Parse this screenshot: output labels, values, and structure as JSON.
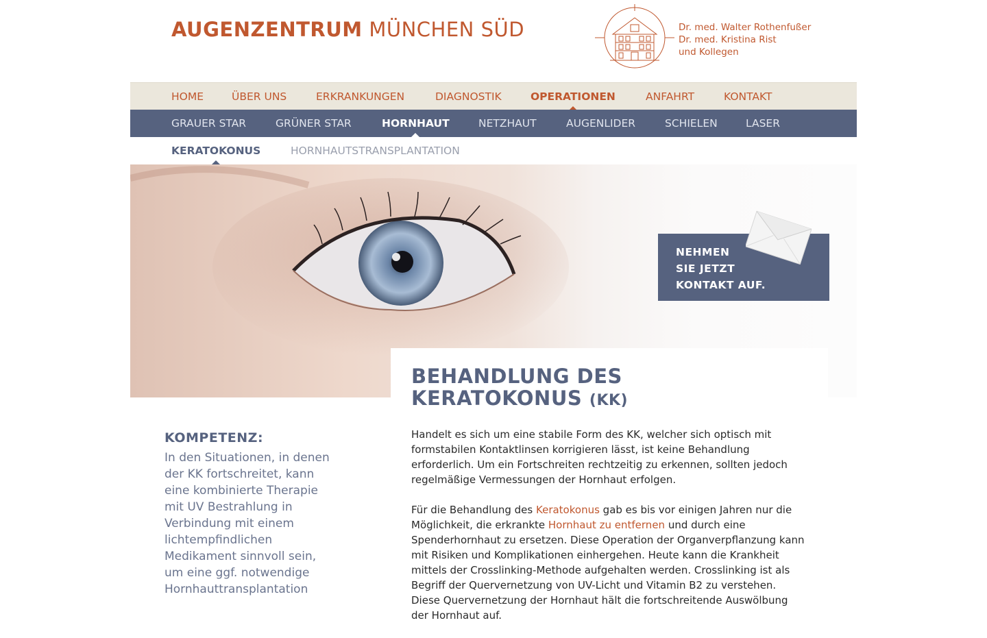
{
  "header": {
    "title_bold": "AUGENZENTRUM",
    "title_light": "MÜNCHEN SÜD",
    "doctors": [
      "Dr. med. Walter Rothenfußer",
      "Dr. med. Kristina Rist",
      "und Kollegen"
    ]
  },
  "nav_main": {
    "active": "OPERATIONEN",
    "items": [
      "HOME",
      "ÜBER UNS",
      "ERKRANKUNGEN",
      "DIAGNOSTIK",
      "OPERATIONEN",
      "ANFAHRT",
      "KONTAKT"
    ]
  },
  "nav_sub": {
    "active": "HORNHAUT",
    "items": [
      "GRAUER STAR",
      "GRÜNER STAR",
      "HORNHAUT",
      "NETZHAUT",
      "AUGENLIDER",
      "SCHIELEN",
      "LASER"
    ]
  },
  "nav_sub2": {
    "active": "KERATOKONUS",
    "items": [
      "KERATOKONUS",
      "HORNHAUTSTRANSPLANTATION"
    ]
  },
  "contact_box": {
    "lines": [
      "NEHMEN",
      "SIE JETZT",
      "KONTAKT AUF."
    ]
  },
  "article": {
    "title_line1": "BEHANDLUNG DES",
    "title_line2": "KERATOKONUS",
    "title_suffix": "(KK)",
    "paragraph1": "Handelt es sich um eine stabile Form des KK, welcher sich optisch mit formstabilen Kontaktlinsen korrigieren lässt, ist keine Behandlung erforderlich. Um ein Fortschreiten rechtzeitig zu erkennen, sollten jedoch regelmäßige Vermessungen der Hornhaut erfolgen.",
    "p2_text1": "Für die Behandlung des ",
    "p2_link1": "Keratokonus",
    "p2_text2": " gab es bis vor einigen Jahren nur die Möglichkeit, die erkrankte ",
    "p2_link2": "Hornhaut zu entfernen",
    "p2_text3": " und durch eine Spenderhornhaut zu ersetzen. Diese Operation der Organverpflanzung kann mit Risiken und Komplikationen einhergehen. Heute kann die Krankheit mittels der Crosslinking-Methode aufgehalten werden. Crosslinking ist als Begriff der Quervernetzung von UV-Licht und Vitamin B2 zu verstehen. Diese Quervernetzung der Hornhaut hält die fortschreitende Auswölbung der Hornhaut auf."
  },
  "sidebar": {
    "heading": "KOMPETENZ:",
    "text": "In den Situationen, in denen der KK fortschreitet, kann eine kombinierte Therapie mit UV Bestrahlung in Verbindung mit einem lichtempfindlichen Medikament sinnvoll sein, um eine ggf. notwendige Hornhauttransplantation"
  },
  "colors": {
    "accent": "#c0582f",
    "nav_blue": "#56627f",
    "nav_beige": "#ebe7dc"
  }
}
